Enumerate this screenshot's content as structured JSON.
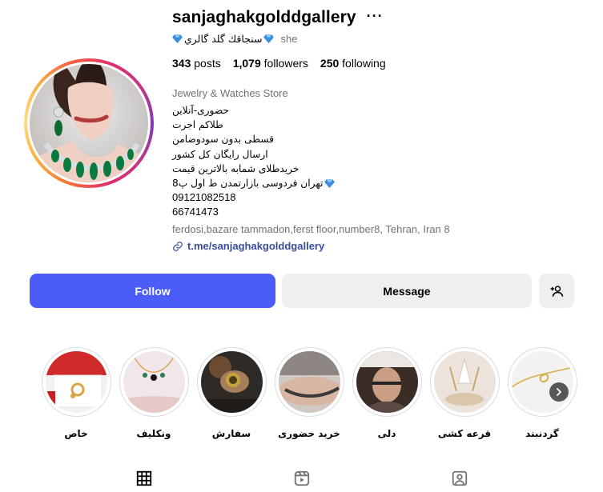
{
  "profile": {
    "username": "sanjaghakgolddgallery",
    "more_label": "···",
    "full_name": "سنجاقك گلد گالري",
    "pronoun": "she",
    "stats": [
      {
        "count": "343",
        "label": "posts"
      },
      {
        "count": "1,079",
        "label": "followers"
      },
      {
        "count": "250",
        "label": "following"
      }
    ],
    "category": "Jewelry & Watches Store",
    "bio_lines": [
      "حضوری-آنلاین",
      "طلاکم اجرت",
      "قسطی بدون سودوضامن",
      "ارسال رایگان کل کشور",
      "خریدطلای شمابه بالاترین قیمت",
      "تهران فردوسی بازارتمدن ط اول پ8",
      "09121082518",
      "66741473"
    ],
    "address": "ferdosi,bazare tammadon,ferst floor,number8, Tehran, Iran 8",
    "link": "t.me/sanjaghakgolddgallery"
  },
  "actions": {
    "follow_label": "Follow",
    "message_label": "Message",
    "suggest_icon": "add-person-icon"
  },
  "highlights": [
    {
      "label": "خاص"
    },
    {
      "label": "ونکلیف"
    },
    {
      "label": "سفارش"
    },
    {
      "label": "خرید حضوری"
    },
    {
      "label": "دلی"
    },
    {
      "label": "قرعه کشی"
    },
    {
      "label": "گردنبند"
    }
  ],
  "tabs": [
    {
      "icon": "grid-icon"
    },
    {
      "icon": "reels-icon"
    },
    {
      "icon": "tagged-icon"
    }
  ],
  "colors": {
    "follow_button": "#4a5df9",
    "secondary_button": "#efefef",
    "muted_text": "#737373",
    "link": "#384e9c",
    "diamond": "#3b8de0"
  }
}
